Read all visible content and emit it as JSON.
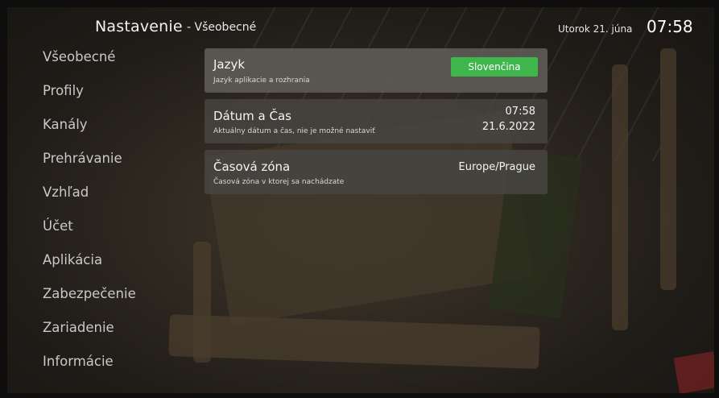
{
  "header": {
    "title": "Nastavenie",
    "subtitle": "- Všeobecné",
    "date": "Utorok 21. júna",
    "time": "07:58"
  },
  "sidebar": {
    "items": [
      {
        "label": "Všeobecné"
      },
      {
        "label": "Profily"
      },
      {
        "label": "Kanály"
      },
      {
        "label": "Prehrávanie"
      },
      {
        "label": "Vzhľad"
      },
      {
        "label": "Účet"
      },
      {
        "label": "Aplikácia"
      },
      {
        "label": "Zabezpečenie"
      },
      {
        "label": "Zariadenie"
      },
      {
        "label": "Informácie"
      }
    ]
  },
  "settings": {
    "language": {
      "title": "Jazyk",
      "description": "Jazyk aplikacie a rozhrania",
      "value": "Slovenčina"
    },
    "datetime": {
      "title": "Dátum a Čas",
      "description": "Aktuálny dátum a čas, nie je možné nastaviť",
      "time": "07:58",
      "date": "21.6.2022"
    },
    "timezone": {
      "title": "Časová zóna",
      "description": "Časová zóna v ktorej sa nachádzate",
      "value": "Europe/Prague"
    }
  },
  "colors": {
    "accent_button": "#3fb64c",
    "card": "#48463f"
  }
}
